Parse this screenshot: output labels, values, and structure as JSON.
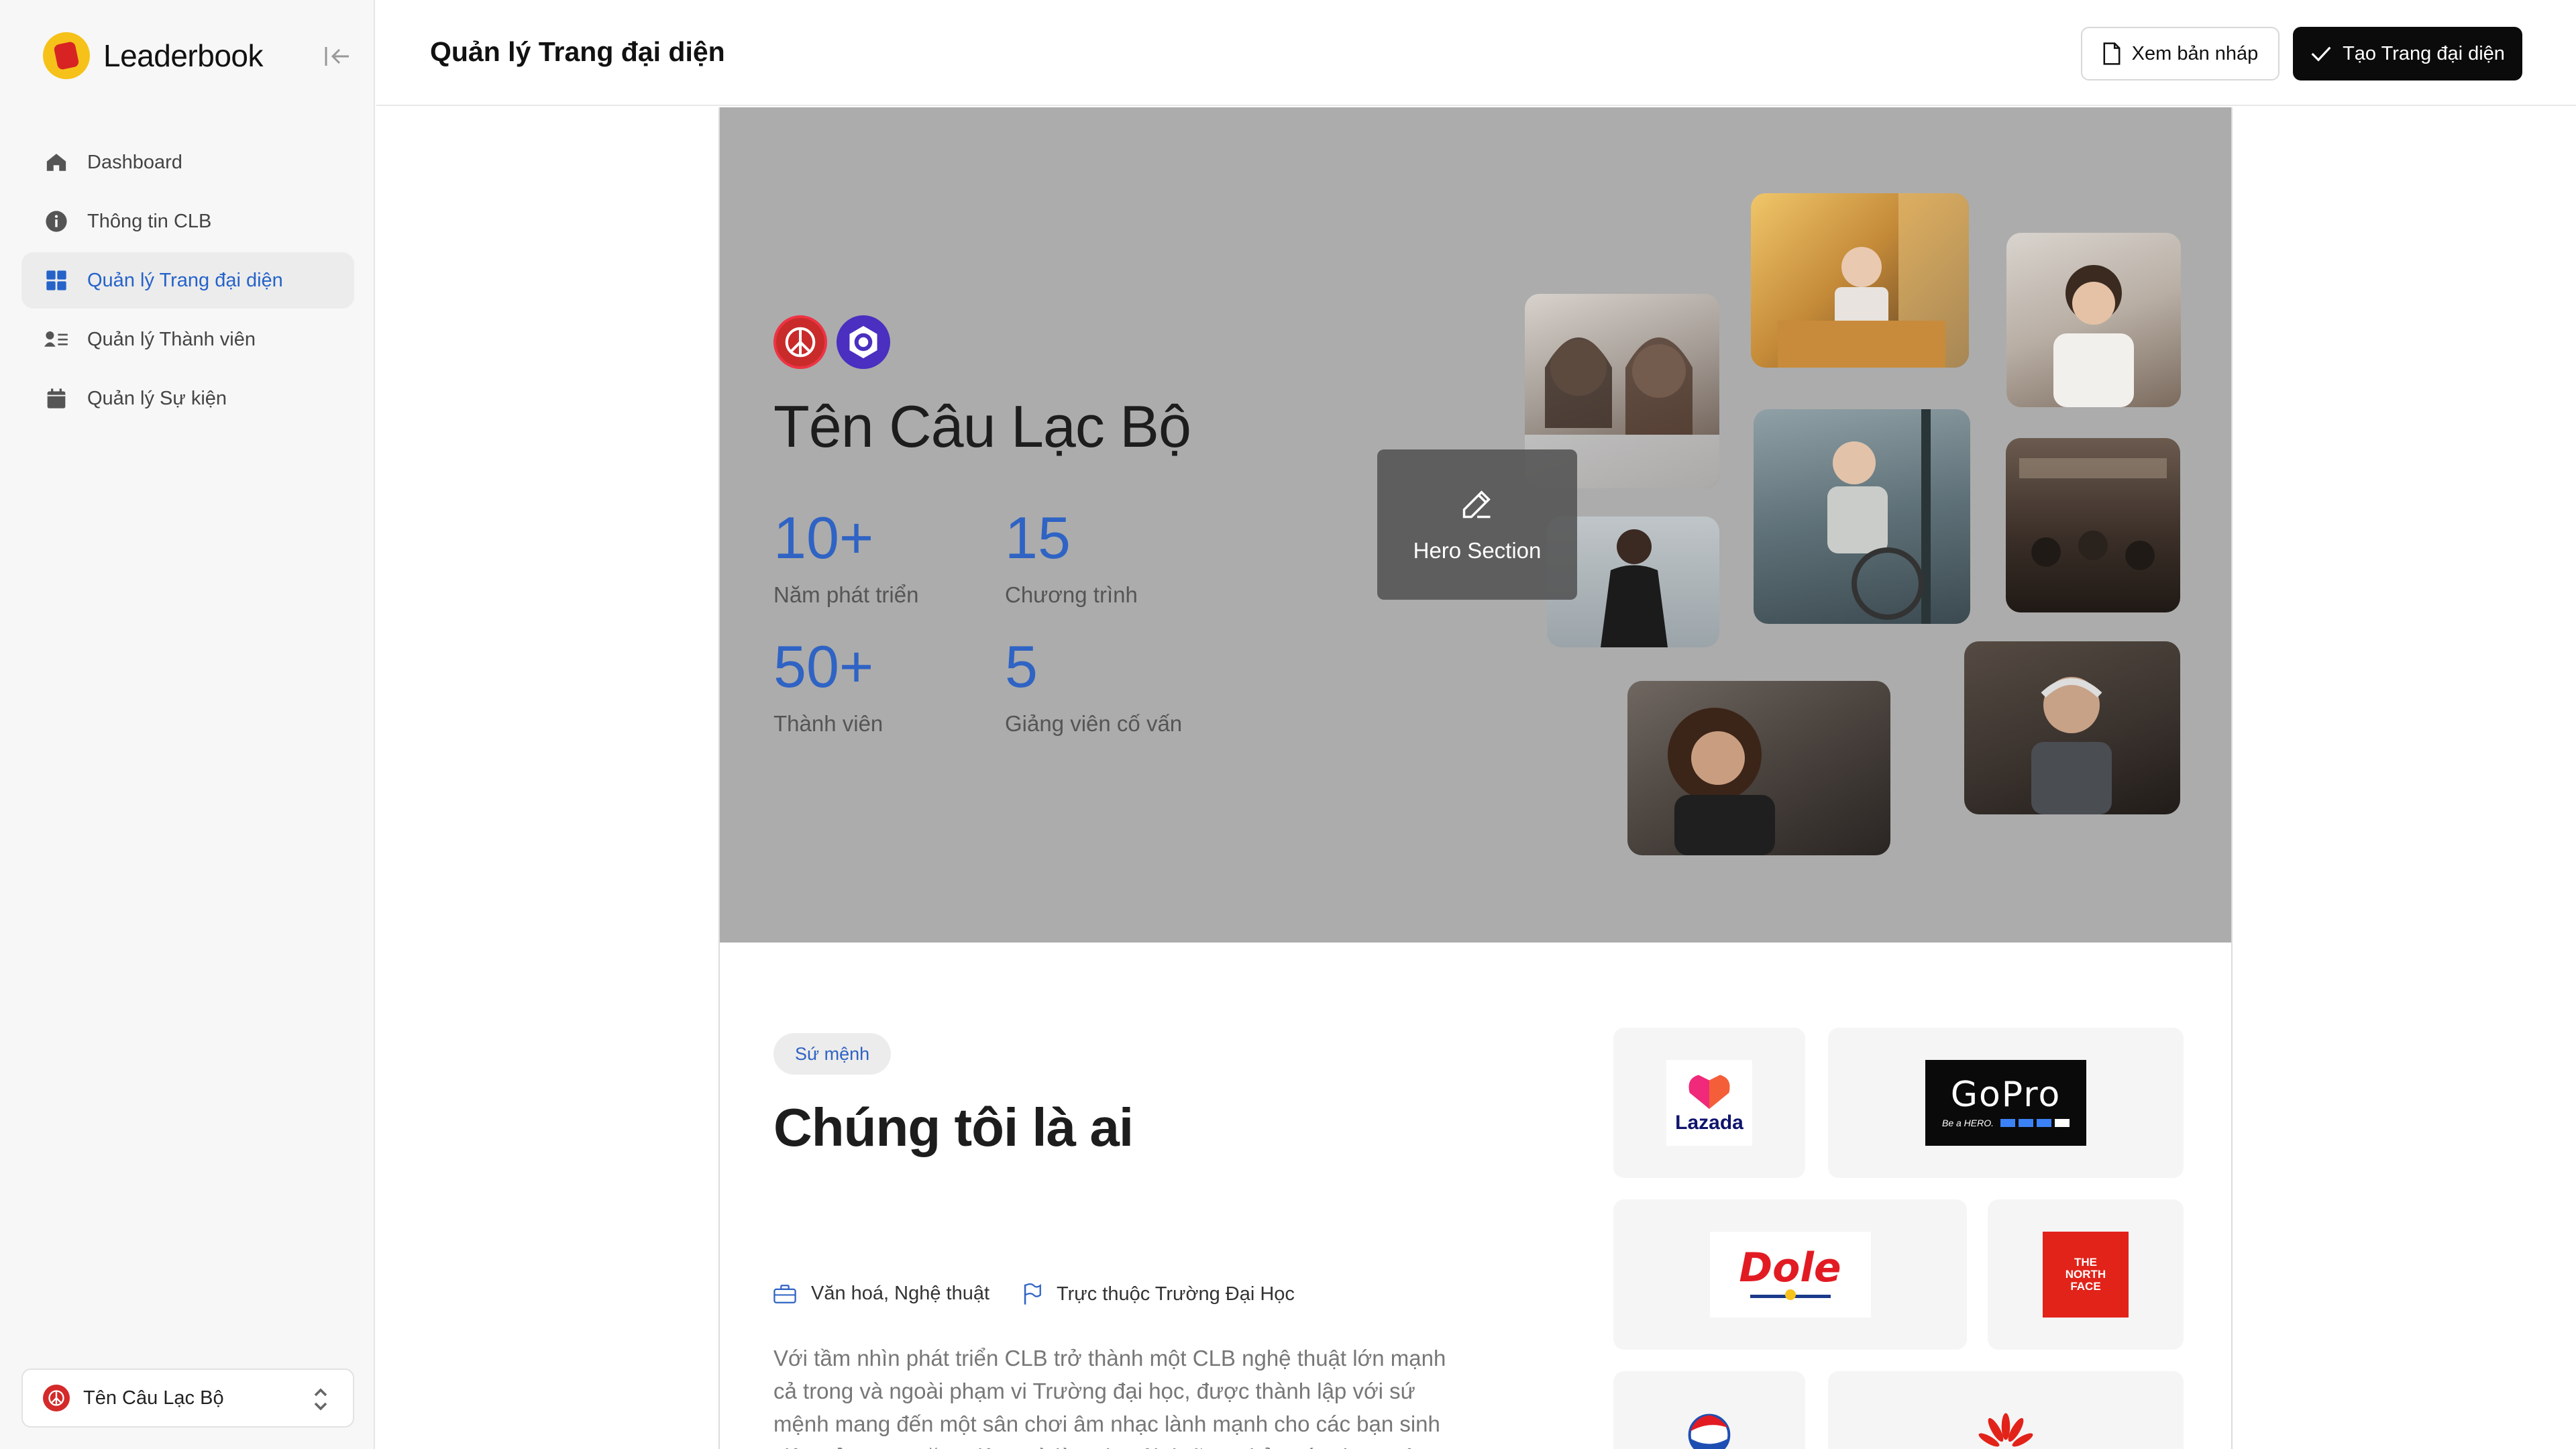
{
  "brand": {
    "name": "Leaderbook"
  },
  "sidebar": {
    "items": [
      {
        "label": "Dashboard",
        "icon": "home-icon"
      },
      {
        "label": "Thông tin CLB",
        "icon": "info-icon"
      },
      {
        "label": "Quản lý Trang đại diện",
        "icon": "grid-icon",
        "active": true
      },
      {
        "label": "Quản lý Thành viên",
        "icon": "members-icon"
      },
      {
        "label": "Quản lý Sự kiện",
        "icon": "calendar-icon"
      }
    ],
    "club_switcher": {
      "name": "Tên Câu Lạc Bộ"
    }
  },
  "header": {
    "title": "Quản lý Trang đại diện",
    "draft_button": "Xem bản nháp",
    "create_button": "Tạo Trang đại diện"
  },
  "hero": {
    "club_name": "Tên Câu Lạc Bộ",
    "stats": [
      {
        "value": "10+",
        "label": "Năm phát triển"
      },
      {
        "value": "15",
        "label": "Chương trình"
      },
      {
        "value": "50+",
        "label": "Thành viên"
      },
      {
        "value": "5",
        "label": "Giảng viên cố vấn"
      }
    ],
    "overlay_label": "Hero Section"
  },
  "about": {
    "tag": "Sứ mệnh",
    "title": "Chúng tôi là ai",
    "category": "Văn hoá, Nghệ thuật",
    "affiliation": "Trực thuộc Trường Đại Học",
    "description": "Với tầm nhìn phát triển CLB  trở thành một CLB nghệ thuật lớn mạnh cả trong và ngoài phạm vi Trường đại học, được thành lập với sứ mệnh mang đến một sân chơi âm nhạc lành mạnh cho các bạn sinh viên trẻ trung, năng động và là nơi nuôi dưỡng, thỏa sức đam mê dành cho những tâm hồn nghệ thuật."
  },
  "partners": {
    "lazada": "Lazada",
    "gopro": "GoPro",
    "gopro_tagline": "Be a HERO.",
    "dole": "Dole",
    "northface_1": "THE",
    "northface_2": "NORTH",
    "northface_3": "FACE"
  },
  "colors": {
    "accent": "#2f63c4",
    "hero_bg": "#acacac",
    "sidebar_bg": "#f7f7f7"
  }
}
